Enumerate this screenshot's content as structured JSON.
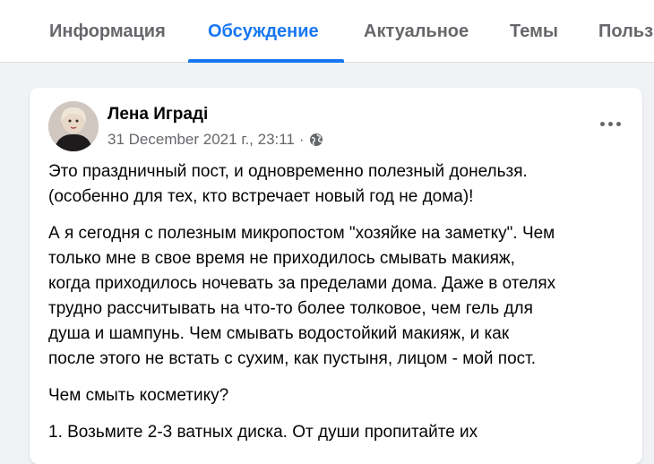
{
  "tabs": [
    {
      "label": "Информация",
      "active": false
    },
    {
      "label": "Обсуждение",
      "active": true
    },
    {
      "label": "Актуальное",
      "active": false
    },
    {
      "label": "Темы",
      "active": false
    },
    {
      "label": "Польз",
      "active": false
    }
  ],
  "colors": {
    "accent": "#1877f2",
    "muted": "#65676b",
    "background": "#f0f2f5"
  },
  "post": {
    "author": "Лена Иградi",
    "timestamp": "31 December 2021 г., 23:11",
    "separator": "·",
    "privacy_icon": "globe-icon",
    "more_icon": "more-options-icon",
    "paragraphs": [
      "Это праздничный пост, и одновременно полезный донельзя.\n(особенно для тех, кто встречает новый год не дома)!",
      "А я сегодня с полезным микропостом \"хозяйке на заметку\". Чем\nтолько мне в свое время не приходилось смывать макияж,\nкогда приходилось ночевать за пределами дома. Даже в отелях\nтрудно рассчитывать на что-то более толковое, чем гель для\nдуша и шампунь. Чем смывать водостойкий макияж, и как\nпосле этого не встать с сухим, как пустыня, лицом - мой пост.",
      "Чем смыть косметику?",
      "1. Возьмите 2-3 ватных диска. От души пропитайте их"
    ]
  }
}
